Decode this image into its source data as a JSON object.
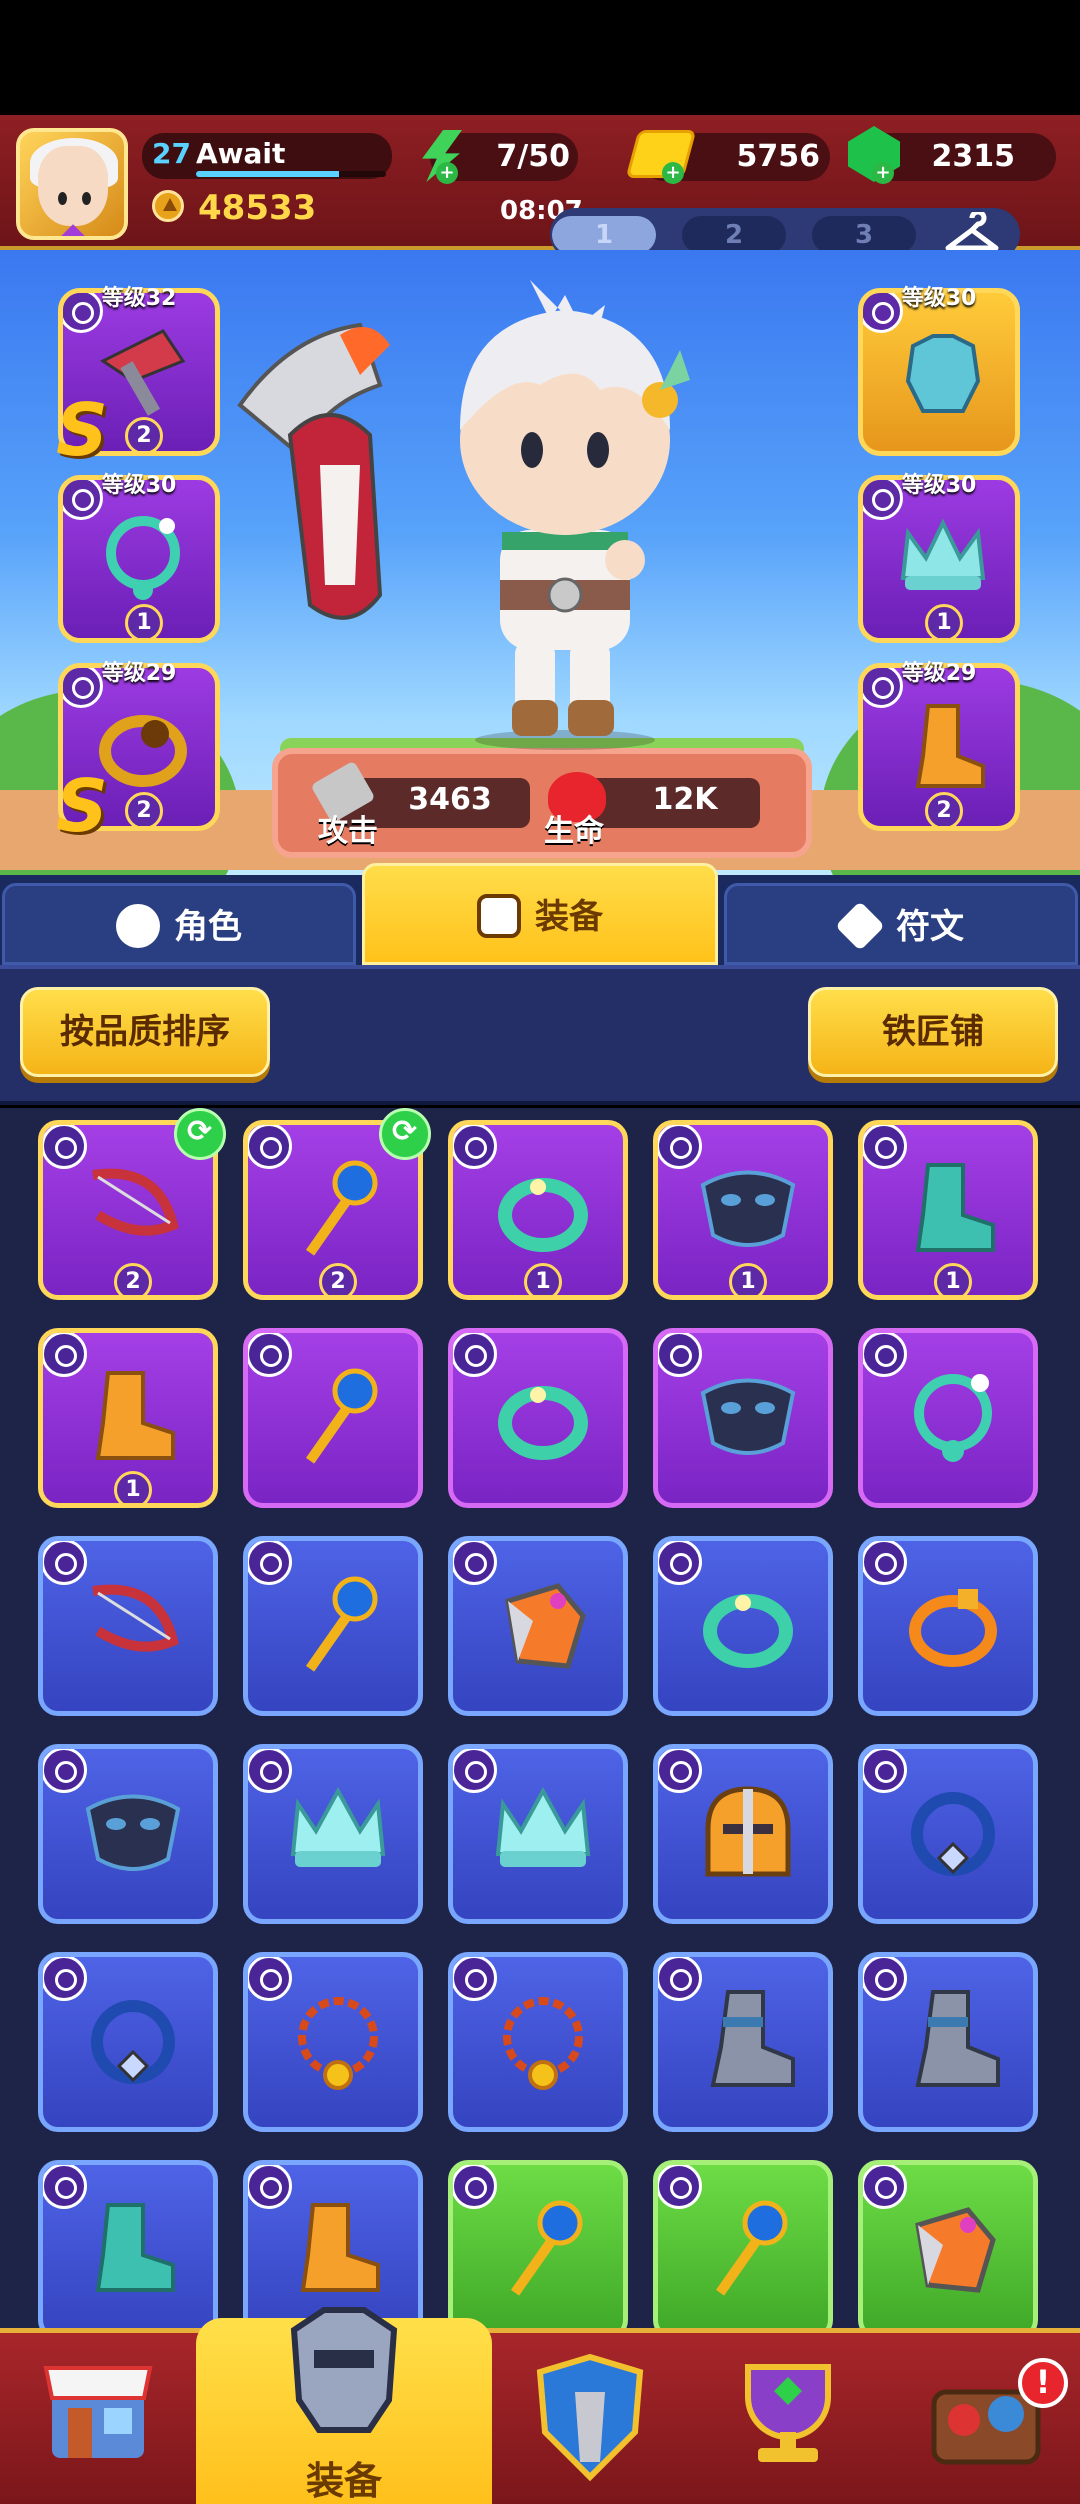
{
  "player": {
    "level": "27",
    "name": "Await",
    "gold": "48533",
    "xp_fraction": 0.75
  },
  "resources": {
    "energy": "7/50",
    "coins": "5756",
    "gems": "2315"
  },
  "timer": "08:07",
  "loadout_pages": [
    "1",
    "2",
    "3"
  ],
  "equipped_left": [
    {
      "level_label": "等级32",
      "badge": "2",
      "rank": "S",
      "item": "axe"
    },
    {
      "level_label": "等级30",
      "badge": "1",
      "item": "necklace"
    },
    {
      "level_label": "等级29",
      "badge": "2",
      "rank": "S",
      "item": "gold-ring"
    }
  ],
  "equipped_right": [
    {
      "level_label": "等级30",
      "badge": "",
      "item": "armor"
    },
    {
      "level_label": "等级30",
      "badge": "1",
      "item": "crown"
    },
    {
      "level_label": "等级29",
      "badge": "2",
      "item": "boots"
    }
  ],
  "stats": {
    "attack_label": "攻击",
    "attack": "3463",
    "hp_label": "生命",
    "hp": "12K"
  },
  "tabs": [
    "角色",
    "装备",
    "符文"
  ],
  "buttons": {
    "sort": "按品质排序",
    "blacksmith": "铁匠铺"
  },
  "bottom_nav": {
    "active_label": "装备",
    "notification": "!"
  },
  "colors": {
    "purple": "#8f33d6",
    "blue": "#4356d6",
    "green": "#52c236",
    "gold_border": "#ffd85a"
  },
  "inventory": [
    {
      "rarity": "pgold",
      "item": "bow",
      "badge": "2",
      "swap": true
    },
    {
      "rarity": "pgold",
      "item": "staff",
      "badge": "2",
      "swap": true
    },
    {
      "rarity": "pgold",
      "item": "ring",
      "badge": "1"
    },
    {
      "rarity": "pgold",
      "item": "mask",
      "badge": "1"
    },
    {
      "rarity": "pgold",
      "item": "boots",
      "badge": "1"
    },
    {
      "rarity": "pgold",
      "item": "boots-orange",
      "badge": "1"
    },
    {
      "rarity": "purple",
      "item": "staff"
    },
    {
      "rarity": "purple",
      "item": "ring"
    },
    {
      "rarity": "purple",
      "item": "mask"
    },
    {
      "rarity": "purple",
      "item": "necklace"
    },
    {
      "rarity": "blue",
      "item": "bow"
    },
    {
      "rarity": "blue",
      "item": "staff"
    },
    {
      "rarity": "blue",
      "item": "gauntlet"
    },
    {
      "rarity": "blue",
      "item": "ring"
    },
    {
      "rarity": "blue",
      "item": "ring-orange"
    },
    {
      "rarity": "blue",
      "item": "mask"
    },
    {
      "rarity": "blue",
      "item": "crown"
    },
    {
      "rarity": "blue",
      "item": "crown"
    },
    {
      "rarity": "blue",
      "item": "helmet"
    },
    {
      "rarity": "blue",
      "item": "amulet"
    },
    {
      "rarity": "blue",
      "item": "amulet"
    },
    {
      "rarity": "blue",
      "item": "chain-necklace"
    },
    {
      "rarity": "blue",
      "item": "chain-necklace"
    },
    {
      "rarity": "blue",
      "item": "iron-boots"
    },
    {
      "rarity": "blue",
      "item": "iron-boots"
    },
    {
      "rarity": "blue",
      "item": "boots"
    },
    {
      "rarity": "blue",
      "item": "boots-orange"
    },
    {
      "rarity": "green",
      "item": "staff"
    },
    {
      "rarity": "green",
      "item": "staff"
    },
    {
      "rarity": "green",
      "item": "gauntlet"
    }
  ]
}
